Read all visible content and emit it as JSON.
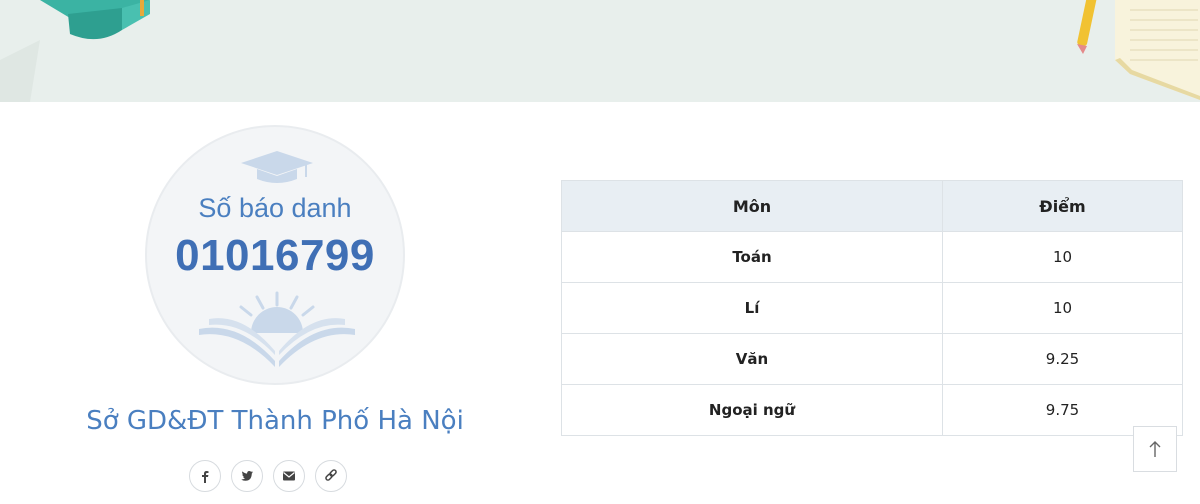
{
  "profile": {
    "registration_label": "Số báo danh",
    "registration_number": "01016799",
    "department": "Sở GD&ĐT Thành Phố Hà Nội"
  },
  "share": [
    {
      "name": "facebook",
      "glyph": "f"
    },
    {
      "name": "twitter",
      "glyph": "twitter"
    },
    {
      "name": "email",
      "glyph": "envelope"
    },
    {
      "name": "copy-link",
      "glyph": "link"
    }
  ],
  "scores": {
    "headers": [
      "Môn",
      "Điểm"
    ],
    "rows": [
      {
        "subject": "Toán",
        "score": "10"
      },
      {
        "subject": "Lí",
        "score": "10"
      },
      {
        "subject": "Văn",
        "score": "9.25"
      },
      {
        "subject": "Ngoại ngữ",
        "score": "9.75"
      }
    ]
  },
  "colors": {
    "accent": "#4a7fc0",
    "banner": "#e8efec",
    "table_header": "#e8eef3"
  }
}
